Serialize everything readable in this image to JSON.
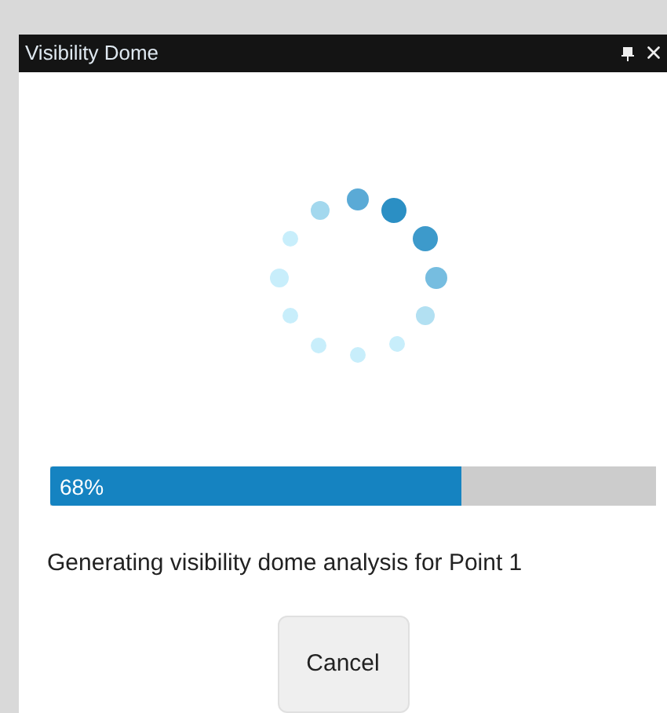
{
  "window": {
    "title": "Visibility Dome"
  },
  "progress": {
    "level": 0.68,
    "reading": "68%"
  },
  "message": "Generating visibility dome analysis for Point 1",
  "buttons": [
    "Cancel"
  ]
}
